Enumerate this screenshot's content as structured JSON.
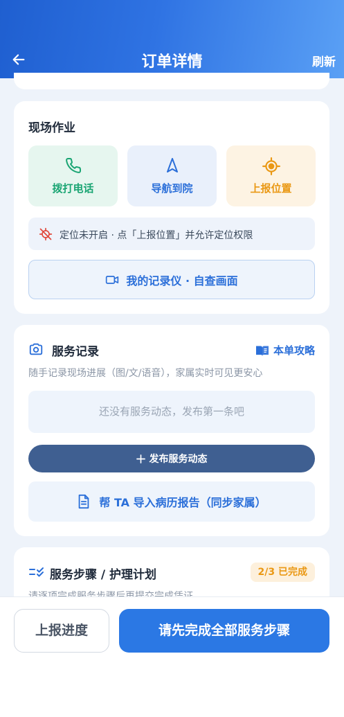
{
  "header": {
    "title": "订单详情",
    "refresh_label": "刷新",
    "gradient": [
      "#1f5fd0",
      "#5aa0f5"
    ]
  },
  "site_work": {
    "title": "现场作业",
    "actions": [
      {
        "label": "拨打电话",
        "icon": "phone-icon",
        "color": "#1aa573"
      },
      {
        "label": "导航到院",
        "icon": "navigation-icon",
        "color": "#2b6fd9"
      },
      {
        "label": "上报位置",
        "icon": "locate-icon",
        "color": "#ea9814"
      }
    ],
    "notice": {
      "icon": "location-off-icon",
      "text": "定位未开启 · 点「上报位置」并允许定位权限"
    },
    "recorder_button": {
      "icon": "video-camera-icon",
      "label": "我的记录仪 · 自查画面"
    }
  },
  "service_record": {
    "title": "服务记录",
    "guide_label": "本单攻略",
    "subtitle": "随手记录现场进展（图/文/语音），家属实时可见更安心",
    "empty_text": "还没有服务动态，发布第一条吧",
    "publish_label": "发布服务动态",
    "import_label": "帮 TA 导入病历报告（同步家属）"
  },
  "service_steps": {
    "title": "服务步骤 / 护理计划",
    "badge": "2/3 已完成",
    "subtitle": "请逐项完成服务步骤后再提交完成凭证"
  },
  "bottom_bar": {
    "report_progress_label": "上报进度",
    "complete_label": "请先完成全部服务步骤",
    "accent": "#2b78e4"
  }
}
